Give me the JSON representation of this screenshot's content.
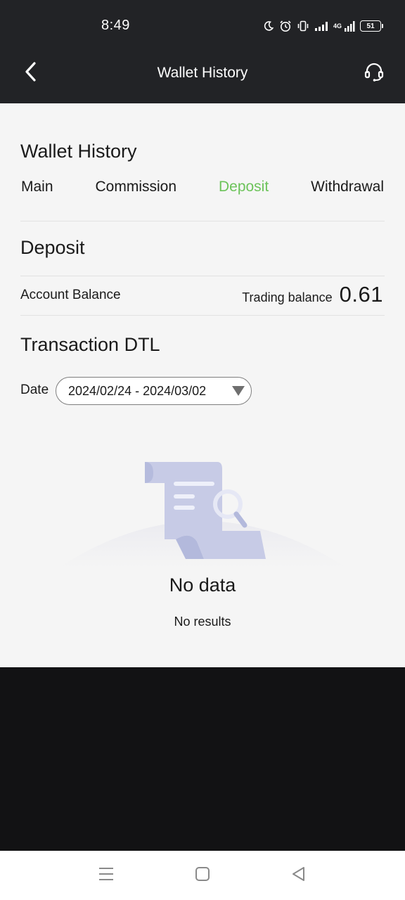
{
  "status_bar": {
    "time": "8:49",
    "network": "4G",
    "battery": "51",
    "icons": [
      "moon-icon",
      "alarm-icon",
      "vibrate-icon",
      "signal-icon",
      "signal-4g-icon",
      "battery-icon"
    ]
  },
  "header": {
    "title": "Wallet History",
    "back_icon": "chevron-left-icon",
    "support_icon": "headset-icon"
  },
  "page": {
    "heading": "Wallet History",
    "tabs": [
      {
        "label": "Main",
        "active": false
      },
      {
        "label": "Commission",
        "active": false
      },
      {
        "label": "Deposit",
        "active": true
      },
      {
        "label": "Withdrawal",
        "active": false
      }
    ],
    "section_title": "Deposit",
    "account_balance_label": "Account Balance",
    "trading_balance_label": "Trading balance",
    "trading_balance_value": "0.61",
    "transaction_title": "Transaction DTL",
    "date_label": "Date",
    "date_range": "2024/02/24 - 2024/03/02",
    "empty_title": "No data",
    "empty_subtitle": "No results"
  },
  "colors": {
    "header_bg": "#222326",
    "content_bg": "#f5f5f5",
    "active_tab": "#6cc35a",
    "dark_bg": "#121214",
    "illustration": "#c7cbe6"
  },
  "nav_bar": {
    "icons": [
      "menu-icon",
      "home-square-icon",
      "back-triangle-icon"
    ]
  }
}
